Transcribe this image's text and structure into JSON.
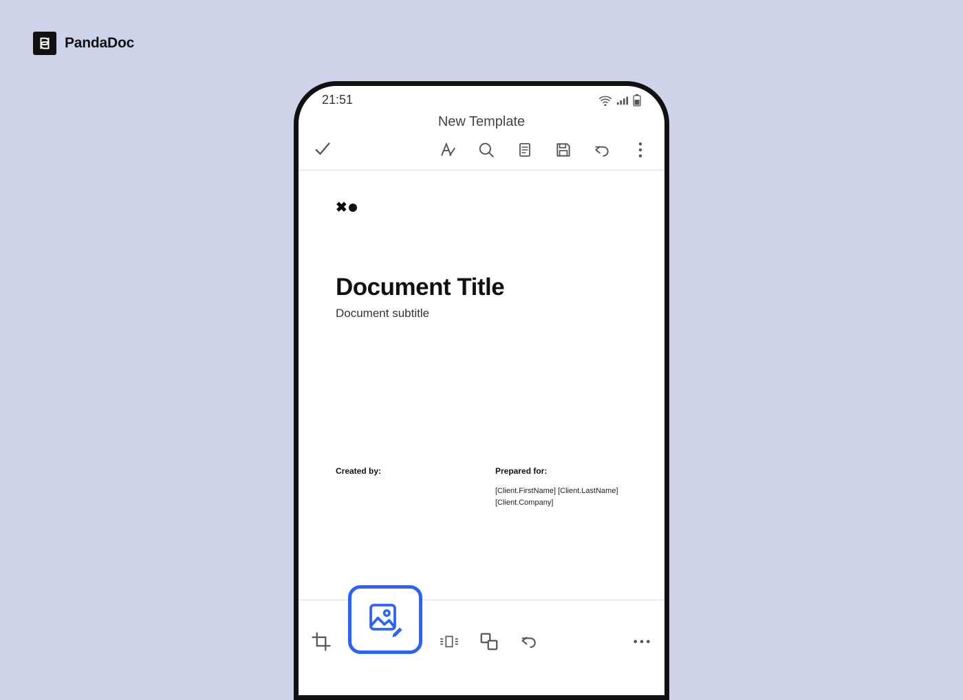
{
  "brand": {
    "name": "PandaDoc"
  },
  "status": {
    "time": "21:51"
  },
  "header": {
    "title": "New Template"
  },
  "toolbar_icons": [
    "confirm",
    "text-style",
    "search",
    "reader",
    "save",
    "undo",
    "more"
  ],
  "document": {
    "title": "Document Title",
    "subtitle": "Document subtitle",
    "created_by_label": "Created by:",
    "prepared_for_label": "Prepared for:",
    "prepared_for_line1": "[Client.FirstName] [Client.LastName]",
    "prepared_for_line2": "[Client.Company]"
  },
  "bottom_tools": [
    "crop",
    "image-edit",
    "spacing",
    "layers",
    "undo",
    "more"
  ]
}
